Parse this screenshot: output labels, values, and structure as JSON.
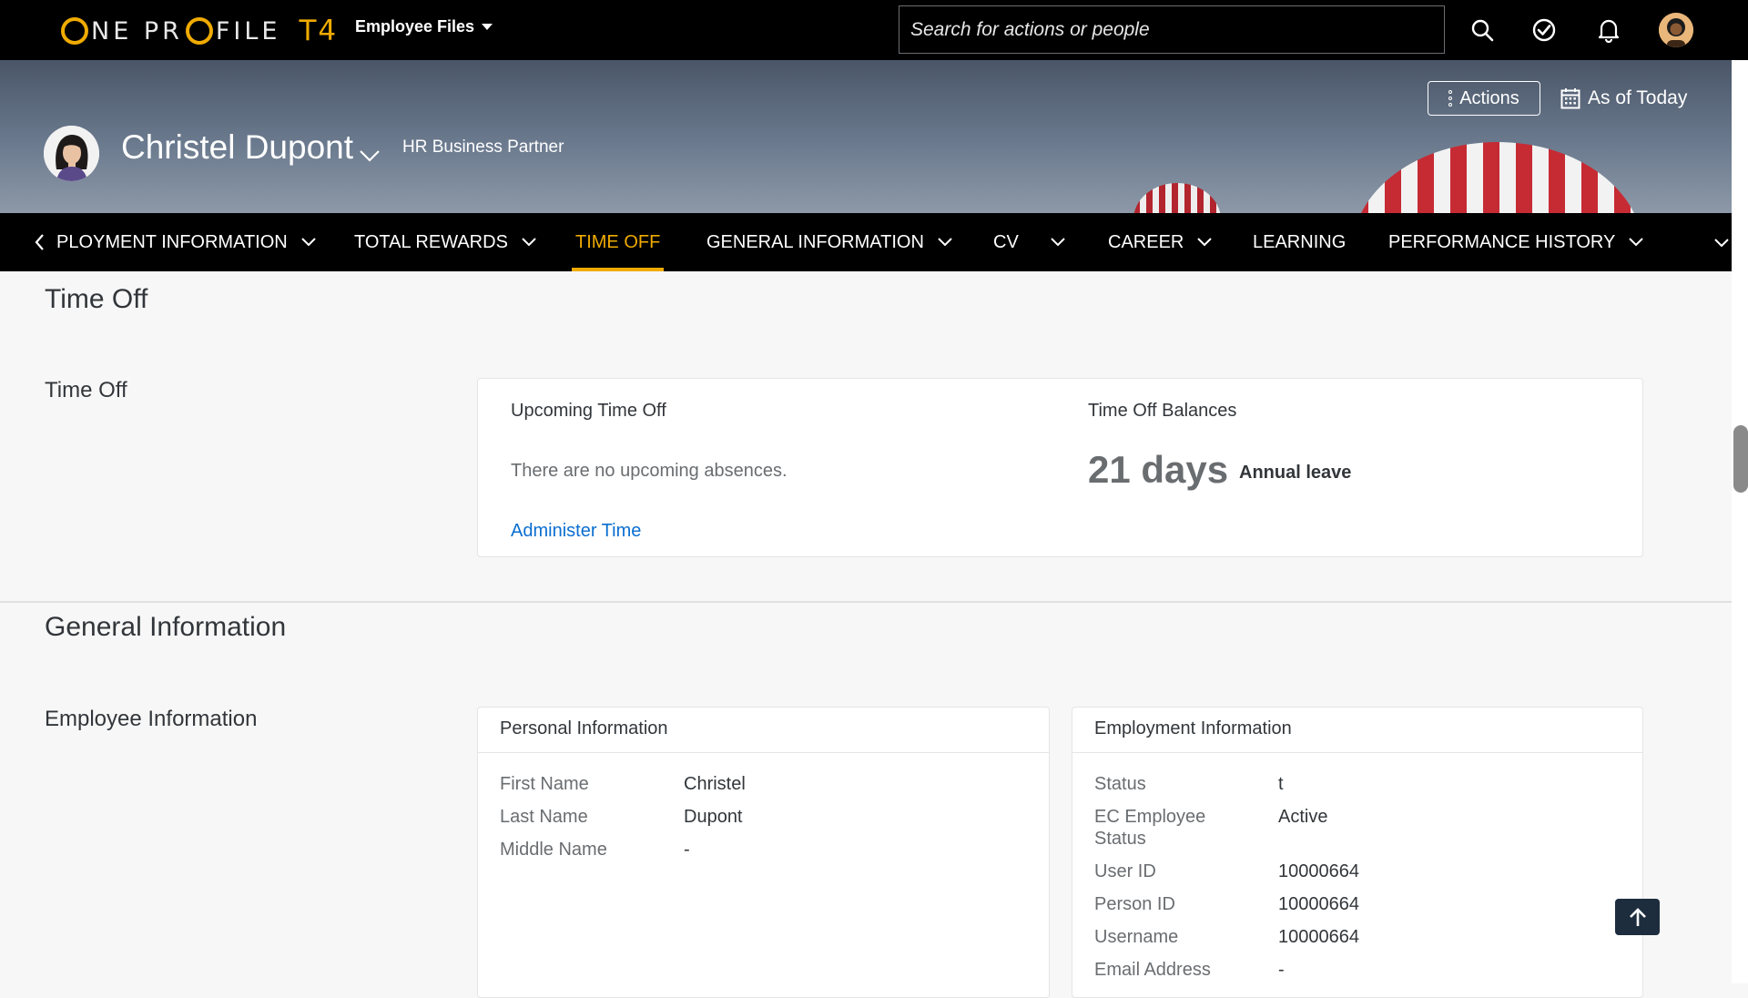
{
  "shell": {
    "logo_parts": [
      "O",
      "NE PR",
      "O",
      "FILE"
    ],
    "logo_suffix": "T4",
    "employee_files": "Employee Files",
    "search_placeholder": "Search for actions or people",
    "icons": [
      "search-icon",
      "approve-check-icon",
      "bell-icon",
      "user-avatar"
    ]
  },
  "header": {
    "name": "Christel Dupont",
    "role": "HR Business Partner",
    "actions_label": "Actions",
    "as_of_label": "As of Today"
  },
  "tabs": [
    {
      "label": "PLOYMENT INFORMATION",
      "has_menu": true
    },
    {
      "label": "TOTAL REWARDS",
      "has_menu": true
    },
    {
      "label": "TIME OFF",
      "has_menu": false,
      "active": true
    },
    {
      "label": "GENERAL INFORMATION",
      "has_menu": true
    },
    {
      "label": "CV",
      "has_menu": true
    },
    {
      "label": "CAREER",
      "has_menu": true
    },
    {
      "label": "LEARNING",
      "has_menu": false
    },
    {
      "label": "PERFORMANCE HISTORY",
      "has_menu": true
    }
  ],
  "time_off": {
    "section_title": "Time Off",
    "subsection": "Time Off",
    "upcoming_title": "Upcoming Time Off",
    "no_absences": "There are no upcoming absences.",
    "administer_link": "Administer Time",
    "balances_title": "Time Off Balances",
    "balance_value": "21 days",
    "balance_type": "Annual leave"
  },
  "general": {
    "section_title": "General Information",
    "subsection": "Employee Information",
    "personal": {
      "title": "Personal Information",
      "rows": [
        {
          "k": "First Name",
          "v": "Christel"
        },
        {
          "k": "Last Name",
          "v": "Dupont"
        },
        {
          "k": "Middle Name",
          "v": "-"
        }
      ]
    },
    "employment": {
      "title": "Employment Information",
      "rows": [
        {
          "k": "Status",
          "v": "t"
        },
        {
          "k": "EC Employee Status",
          "v": "Active"
        },
        {
          "k": "User ID",
          "v": "10000664"
        },
        {
          "k": "Person ID",
          "v": "10000664"
        },
        {
          "k": "Username",
          "v": "10000664"
        },
        {
          "k": "Email Address",
          "v": "-"
        }
      ]
    }
  },
  "colors": {
    "accent": "#f0ab00",
    "link": "#0a6ed1",
    "shell": "#000000"
  }
}
